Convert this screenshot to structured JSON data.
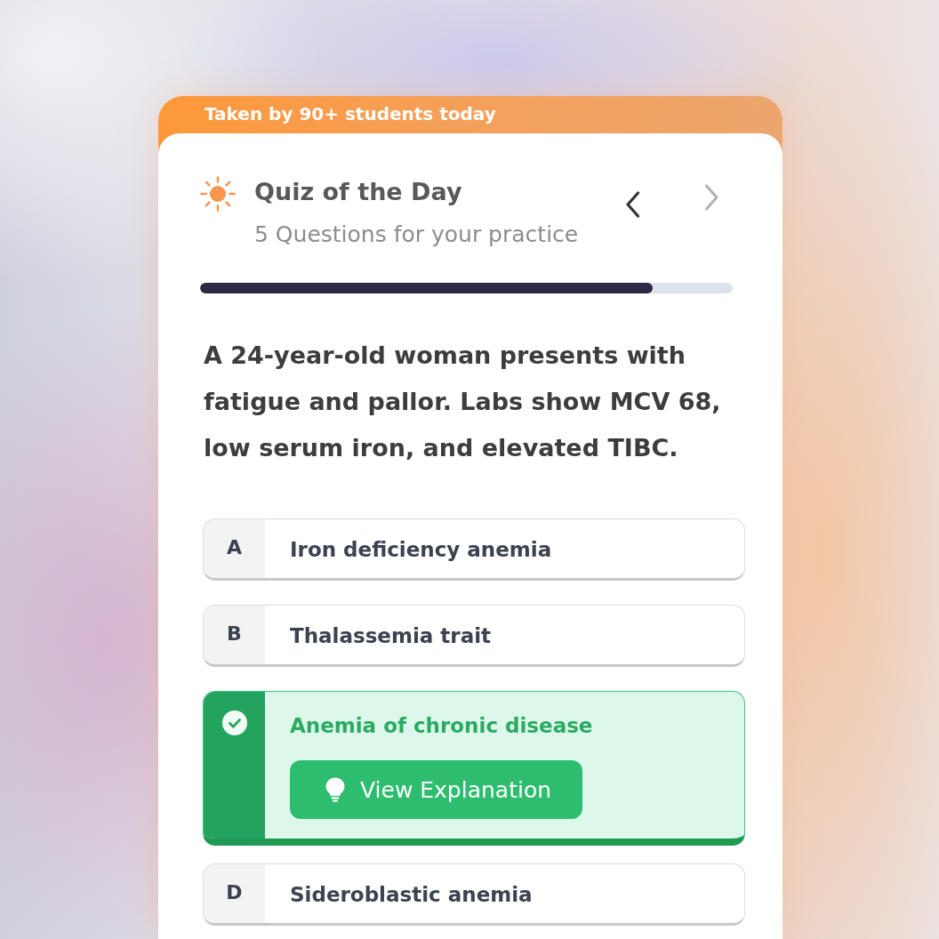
{
  "banner": {
    "text": "Taken by 90+ students today"
  },
  "header": {
    "title": "Quiz of the Day",
    "subtitle": "5 Questions for your practice"
  },
  "nav_buttons": [
    {
      "kind": "previous",
      "disabled": false
    },
    {
      "kind": "next",
      "disabled": true
    }
  ],
  "progress": {
    "level": 0.85
  },
  "question": "A 24-year-old woman presents with fatigue and pallor. Labs show MCV 68, low serum iron, and elevated TIBC.",
  "options": [
    {
      "letter": "A",
      "text": "Iron deficiency anemia",
      "selected": false,
      "correct": false
    },
    {
      "letter": "B",
      "text": "Thalassemia trait",
      "selected": false,
      "correct": false
    },
    {
      "text": "Anemia of chronic disease",
      "selected": true,
      "correct": true,
      "button": "View Explanation"
    },
    {
      "letter": "D",
      "text": "Sideroblastic anemia",
      "selected": false,
      "correct": false
    }
  ]
}
